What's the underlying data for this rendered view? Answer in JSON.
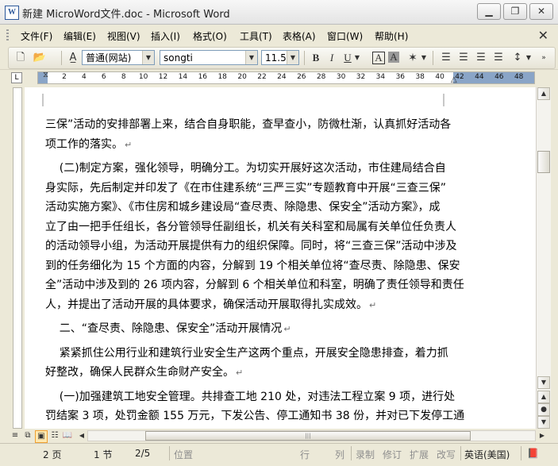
{
  "window": {
    "title": "新建 MicroWord文件.doc - Microsoft Word",
    "app_icon": "word-doc-icon"
  },
  "menu": {
    "items": [
      "文件(F)",
      "编辑(E)",
      "视图(V)",
      "插入(I)",
      "格式(O)",
      "工具(T)",
      "表格(A)",
      "窗口(W)",
      "帮助(H)"
    ]
  },
  "toolbar": {
    "style_value": "普通(网站)",
    "font_value": "songti",
    "size_value": "11.5",
    "bold": "B",
    "italic": "I",
    "underline": "U",
    "char_border": "A",
    "char_shade": "A"
  },
  "ruler": {
    "ticks": [
      "2",
      "4",
      "6",
      "8",
      "10",
      "12",
      "14",
      "16",
      "18",
      "20",
      "22",
      "24",
      "26",
      "28",
      "30",
      "32",
      "34",
      "36",
      "38",
      "40",
      "42",
      "44",
      "46",
      "48"
    ]
  },
  "document": {
    "lines": [
      "三保”活动的安排部署上来，结合自身职能，查早查小，防微杜渐，认真抓好活动各",
      "项工作的落实。",
      "    (二)制定方案，强化领导，明确分工。为切实开展好这次活动，市住建局结合自",
      "身实际，先后制定并印发了《在市住建系统“三严三实”专题教育中开展“三查三保”",
      "活动实施方案》、《市住房和城乡建设局“查尽责、除隐患、保安全”活动方案》，成",
      "立了由一把手任组长，各分管领导任副组长，机关有关科室和局属有关单位任负责人",
      "的活动领导小组，为活动开展提供有力的组织保障。同时，将“三查三保”活动中涉及",
      "到的任务细化为 15 个方面的内容，分解到 19 个相关单位将“查尽责、除隐患、保安",
      "全”活动中涉及到的 26 项内容，分解到 6 个相关单位和科室，明确了责任领导和责任",
      "人，并提出了活动开展的具体要求，确保活动开展取得扎实成效。",
      "    二、“查尽责、除隐患、保安全”活动开展情况",
      "    紧紧抓住公用行业和建筑行业安全生产这两个重点，开展安全隐患排查，着力抓",
      "好整改，确保人民群众生命财产安全。",
      "    (一)加强建筑工地安全管理。共排查工地 210 处，对违法工程立案 9 项，进行处",
      "罚结案 3 项，处罚金额 155 万元，下发公告、停工通知书 38 份，并对已下发停工通"
    ],
    "paragraph_mark": "↵"
  },
  "status": {
    "page": "2 页",
    "section": "1 节",
    "page_of": "2/5",
    "position": "位置",
    "line": "行",
    "column": "列",
    "rec": "录制",
    "trk": "修订",
    "ext": "扩展",
    "ovr": "改写",
    "language": "英语(美国)"
  }
}
